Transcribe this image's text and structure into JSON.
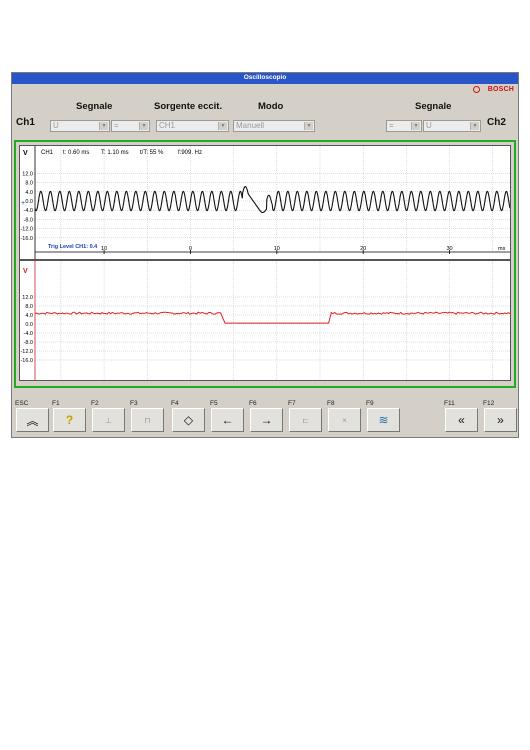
{
  "window": {
    "title": "Oscilloscopio"
  },
  "brand": {
    "name": "BOSCH",
    "color": "#cc1111"
  },
  "controls": {
    "ch1_label": "Ch1",
    "ch2_label": "Ch2",
    "left_signal_header": "Segnale",
    "source_header": "Sorgente eccit.",
    "mode_header": "Modo",
    "right_signal_header": "Segnale",
    "left_signal_value": "U",
    "left_coupling_value": "=",
    "source_value": "CH1",
    "mode_value": "Manuell",
    "right_coupling_value": "=",
    "right_signal_value": "U"
  },
  "ch1_panel": {
    "unit": "V",
    "info": {
      "channel": "CH1",
      "tz": "t: 0.60 ms",
      "period": "T: 1.10 ms",
      "duty": "t/T: 55 %",
      "freq": "f:909. Hz"
    },
    "y_ticks": [
      "12.0",
      "8.0",
      "4.0",
      "0.0",
      "-4.0",
      "-8.0",
      "-12.0",
      "-16.0"
    ],
    "trig_label": "Trig Level CH1: 0.4",
    "x_ticks": [
      "10",
      "0",
      "10",
      "20",
      "30"
    ],
    "x_unit": "ms"
  },
  "ch2_panel": {
    "unit": "V",
    "y_ticks": [
      "12.0",
      "8.0",
      "4.0",
      "0.0",
      "-4.0",
      "-8.0",
      "-12.0",
      "-16.0"
    ]
  },
  "function_keys": [
    {
      "key": "ESC",
      "icon": "double-chevron-up-icon",
      "glyph": "︽",
      "enabled": true
    },
    {
      "key": "F1",
      "icon": "help-icon",
      "glyph": "?",
      "enabled": true
    },
    {
      "key": "F2",
      "icon": "cursor-icon",
      "glyph": "⊥",
      "enabled": false
    },
    {
      "key": "F3",
      "icon": "trigger-icon",
      "glyph": "⊓",
      "enabled": false
    },
    {
      "key": "F4",
      "icon": "diamond-icon",
      "glyph": "◇",
      "enabled": true
    },
    {
      "key": "F5",
      "icon": "arrow-left-icon",
      "glyph": "←",
      "enabled": true
    },
    {
      "key": "F6",
      "icon": "arrow-right-icon",
      "glyph": "→",
      "enabled": true
    },
    {
      "key": "F7",
      "icon": "zoom-icon",
      "glyph": "⊏",
      "enabled": false
    },
    {
      "key": "F8",
      "icon": "close-x-icon",
      "glyph": "×",
      "enabled": false
    },
    {
      "key": "F9",
      "icon": "waveform-icon",
      "glyph": "≋",
      "enabled": true
    },
    {
      "key": "F11",
      "icon": "double-chevron-left-icon",
      "glyph": "«",
      "enabled": true
    },
    {
      "key": "F12",
      "icon": "double-chevron-right-icon",
      "glyph": "»",
      "enabled": true
    }
  ],
  "colors": {
    "titlebar": "#2a55c8",
    "frame": "#22aa22",
    "ch1_trace": "#111111",
    "ch2_trace": "#dd2222",
    "trig_text": "#1a3fb0",
    "ch2_axis": "#cc2222"
  },
  "chart_data": [
    {
      "type": "line",
      "name": "CH1",
      "x_range_ms": [
        -18,
        37
      ],
      "ylim": [
        -16,
        16
      ],
      "waveform": "sine",
      "amplitude_v": 4.2,
      "period_ms": 1.1,
      "frequency_hz": 909,
      "glitch_windows_ms": [
        [
          6,
          9.5
        ]
      ],
      "y_ticks": [
        12,
        8,
        4,
        0,
        -4,
        -8,
        -12,
        -16
      ],
      "x_ticks": [
        -10,
        0,
        10,
        20,
        30
      ]
    },
    {
      "type": "line",
      "name": "CH2",
      "ylim": [
        -16,
        16
      ],
      "points": [
        [
          -18,
          4.8
        ],
        [
          3.5,
          4.8
        ],
        [
          4,
          0.4
        ],
        [
          16,
          0.4
        ],
        [
          16.3,
          4.8
        ],
        [
          37,
          4.8
        ]
      ],
      "y_ticks": [
        12,
        8,
        4,
        0,
        -4,
        -8,
        -12,
        -16
      ]
    }
  ]
}
